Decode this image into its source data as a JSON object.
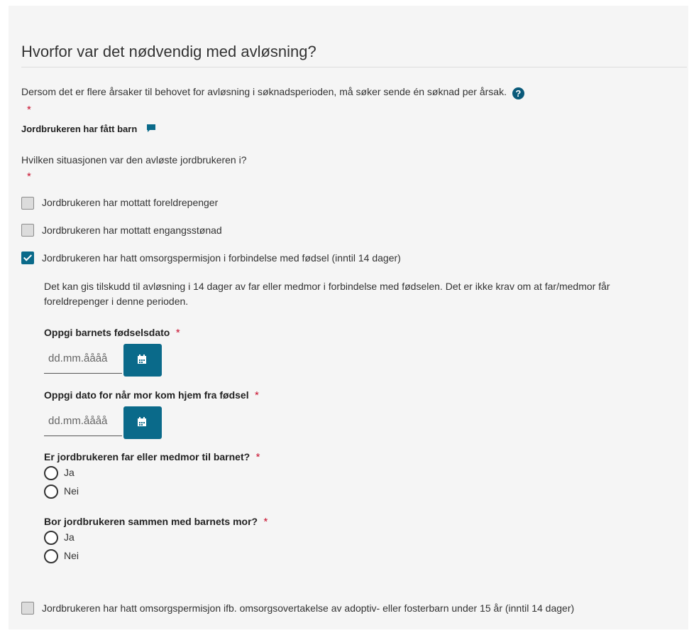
{
  "section": {
    "title": "Hvorfor var det nødvendig med avløsning?",
    "info_text": "Dersom det er flere årsaker til behovet for avløsning i søknadsperioden, må søker sende én søknad per årsak.",
    "help_glyph": "?",
    "required_marker": "*",
    "reason_label": "Jordbrukeren har fått barn",
    "situation_question": "Hvilken situasjonen var den avløste jordbrukeren i?"
  },
  "options": [
    {
      "label": "Jordbrukeren har mottatt foreldrepenger",
      "checked": false
    },
    {
      "label": "Jordbrukeren har mottatt engangsstønad",
      "checked": false
    },
    {
      "label": "Jordbrukeren har hatt omsorgspermisjon i forbindelse med fødsel (inntil 14 dager)",
      "checked": true
    },
    {
      "label": "Jordbrukeren har hatt omsorgspermisjon ifb. omsorgsovertakelse av adoptiv- eller fosterbarn under 15 år (inntil 14 dager)",
      "checked": false
    }
  ],
  "detail": {
    "description": "Det kan gis tilskudd til avløsning i 14 dager av far eller medmor i forbindelse med fødselen. Det er ikke krav om at far/medmor får foreldrepenger i denne perioden.",
    "birthdate_label": "Oppgi barnets fødselsdato",
    "birthdate_placeholder": "dd.mm.åååå",
    "homecoming_label": "Oppgi dato for når mor kom hjem fra fødsel",
    "homecoming_placeholder": "dd.mm.åååå",
    "q_father_label": "Er jordbrukeren far eller medmor til barnet?",
    "q_father_options": [
      "Ja",
      "Nei"
    ],
    "q_cohab_label": "Bor jordbrukeren sammen med barnets mor?",
    "q_cohab_options": [
      "Ja",
      "Nei"
    ]
  },
  "colors": {
    "accent": "#0a6a8a",
    "required": "#c8102e",
    "panel": "#f5f5f5"
  }
}
